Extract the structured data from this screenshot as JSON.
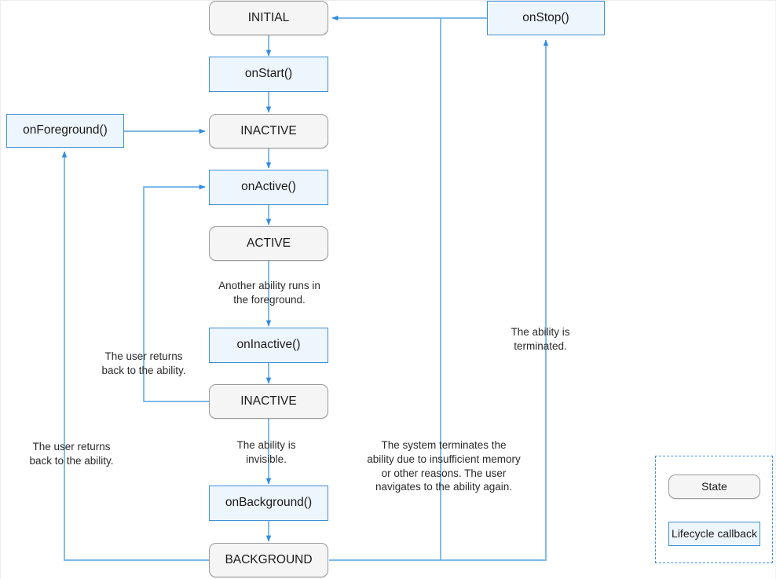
{
  "diagram": {
    "title": "Ability lifecycle state diagram",
    "colors": {
      "arrow": "#4a9ddd",
      "callback_border": "#3d90d7",
      "callback_fill": "#eef6fd",
      "state_border": "#9a9a9a",
      "state_fill": "#f5f5f5",
      "text": "#1a1a1a",
      "canvas": "#ffffff"
    },
    "nodes": [
      {
        "id": "initial",
        "label": "INITIAL",
        "kind": "state"
      },
      {
        "id": "onstart",
        "label": "onStart()",
        "kind": "callback"
      },
      {
        "id": "inactive1",
        "label": "INACTIVE",
        "kind": "state"
      },
      {
        "id": "onactive",
        "label": "onActive()",
        "kind": "callback"
      },
      {
        "id": "active",
        "label": "ACTIVE",
        "kind": "state"
      },
      {
        "id": "oninactive",
        "label": "onInactive()",
        "kind": "callback"
      },
      {
        "id": "inactive2",
        "label": "INACTIVE",
        "kind": "state"
      },
      {
        "id": "onbackground",
        "label": "onBackground()",
        "kind": "callback"
      },
      {
        "id": "background",
        "label": "BACKGROUND",
        "kind": "state"
      },
      {
        "id": "onforeground",
        "label": "onForeground()",
        "kind": "callback"
      },
      {
        "id": "onstop",
        "label": "onStop()",
        "kind": "callback"
      }
    ],
    "edge_labels": {
      "another_ability": "Another ability runs in\nthe foreground.",
      "user_returns_mid": "The user returns\nback to the ability.",
      "ability_invisible": "The ability is\ninvisible.",
      "user_returns_left": "The user returns\nback to the ability.",
      "system_terminates": "The system terminates the\nability due to insufficient memory\nor other reasons. The user\nnavigates to the ability again.",
      "ability_terminated": "The ability is\nterminated."
    },
    "legend": {
      "state_label": "State",
      "callback_label": "Lifecycle callback"
    }
  }
}
